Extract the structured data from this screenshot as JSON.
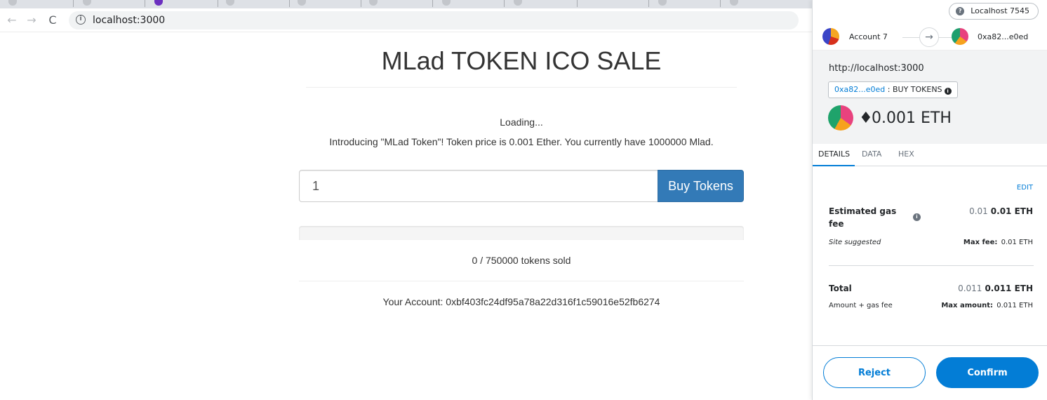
{
  "browser": {
    "url": "localhost:3000",
    "back_icon": "arrow-left-icon",
    "forward_icon": "arrow-right-icon",
    "reload_icon": "reload-icon",
    "info_icon": "info-icon"
  },
  "dapp": {
    "title": "MLad TOKEN ICO SALE",
    "loading": "Loading...",
    "intro": "Introducing \"MLad Token\"! Token price is 0.001 Ether. You currently have 1000000 Mlad.",
    "quantity_value": "1",
    "buy_label": "Buy Tokens",
    "tokens_sold": 0,
    "tokens_available": 750000,
    "sold_text": "0 / 750000 tokens sold",
    "progress_fraction": 0,
    "account_text": "Your Account: 0xbf403fc24df95a78a22d316f1c59016e52fb6274"
  },
  "metamask": {
    "network": "Localhost 7545",
    "network_icon": "question-icon",
    "from_account": "Account 7",
    "to_address": "0xa82...e0ed",
    "arrow_icon": "arrow-right-icon",
    "origin": "http://localhost:3000",
    "method_address": "0xa82...e0ed",
    "method_sep": " : ",
    "method_name": "BUY TOKENS",
    "eth_glyph": "♦",
    "amount": "0.001 ETH",
    "tabs": [
      "DETAILS",
      "DATA",
      "HEX"
    ],
    "edit_label": "EDIT",
    "gas_label": "Estimated gas fee",
    "gas_secondary": "0.01",
    "gas_primary": "0.01 ETH",
    "site_suggested": "Site suggested",
    "max_fee_label": "Max fee:",
    "max_fee_value": "0.01 ETH",
    "total_label": "Total",
    "total_secondary": "0.011",
    "total_primary": "0.011 ETH",
    "total_sub": "Amount + gas fee",
    "max_amount_label": "Max amount:",
    "max_amount_value": "0.011 ETH",
    "reject_label": "Reject",
    "confirm_label": "Confirm",
    "accent_color": "#037dd6"
  }
}
